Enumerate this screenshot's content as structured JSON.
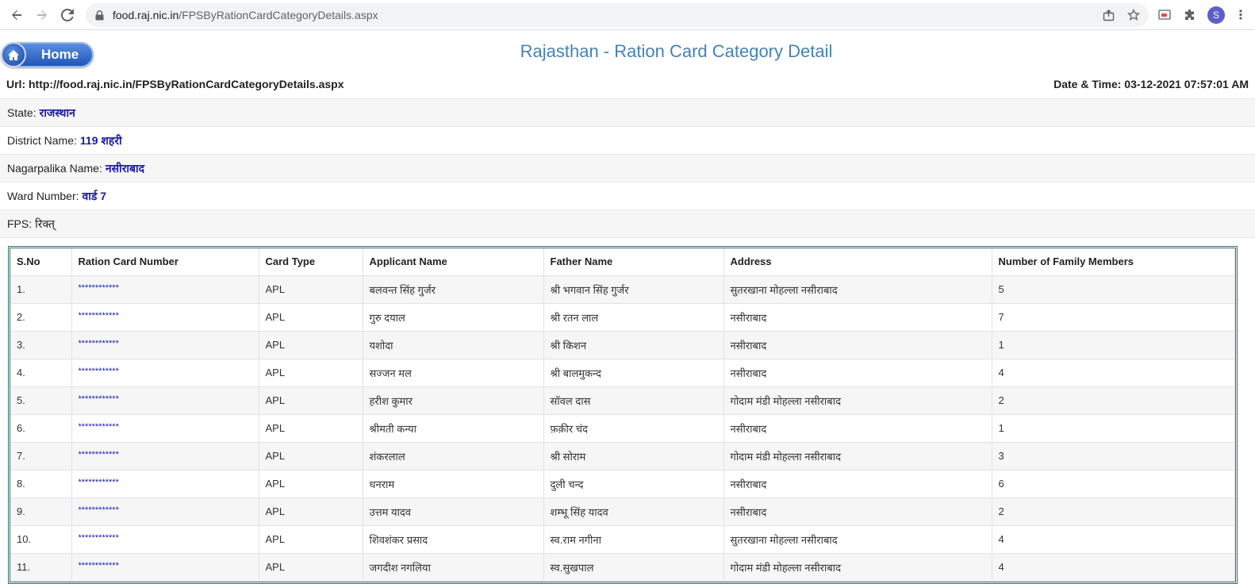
{
  "browser": {
    "url_domain": "food.raj.nic.in",
    "url_path": "/FPSByRationCardCategoryDetails.aspx",
    "avatar_letter": "S"
  },
  "header": {
    "home_label": "Home",
    "title": "Rajasthan - Ration Card Category Detail"
  },
  "info": {
    "url_label": "Url: http://food.raj.nic.in/FPSByRationCardCategoryDetails.aspx",
    "datetime_label": "Date & Time: 03-12-2021 07:57:01 AM"
  },
  "fields": {
    "state_label": "State:",
    "state_value": "राजस्थान",
    "district_label": "District Name:",
    "district_value": "119 शहरी",
    "nagarpalika_label": "Nagarpalika Name:",
    "nagarpalika_value": "नसीराबाद",
    "ward_label": "Ward Number:",
    "ward_value": "वार्ड 7",
    "fps_label": "FPS:",
    "fps_value": "रिक्त्"
  },
  "table": {
    "columns": [
      "S.No",
      "Ration Card Number",
      "Card Type",
      "Applicant Name",
      "Father Name",
      "Address",
      "Number of Family Members"
    ],
    "rows": [
      [
        "1.",
        "************",
        "APL",
        "बलवन्त सिंह गुर्जर",
        "श्री भगवान सिंह गुर्जर",
        "सुतरखाना मोहल्ला नसीराबाद",
        "5"
      ],
      [
        "2.",
        "************",
        "APL",
        "गुरु दयाल",
        "श्री रतन लाल",
        "नसीराबाद",
        "7"
      ],
      [
        "3.",
        "************",
        "APL",
        "यशोदा",
        "श्री किशन",
        "नसीराबाद",
        "1"
      ],
      [
        "4.",
        "************",
        "APL",
        "सज्जन मल",
        "श्री बालमुकन्द",
        "नसीराबाद",
        "4"
      ],
      [
        "5.",
        "************",
        "APL",
        "हरीश कुमार",
        "सॉवल दास",
        "गोदाम मंडी मोहल्ला नसीराबाद",
        "2"
      ],
      [
        "6.",
        "************",
        "APL",
        "श्रीमती कन्या",
        "फ़क़ीर चंद",
        "नसीराबाद",
        "1"
      ],
      [
        "7.",
        "************",
        "APL",
        "शंकरलाल",
        "श्री सोराम",
        "गोदाम मंडी मोहल्ला नसीराबाद",
        "3"
      ],
      [
        "8.",
        "************",
        "APL",
        "धनराम",
        "दुली चन्द",
        "नसीराबाद",
        "6"
      ],
      [
        "9.",
        "************",
        "APL",
        "उत्तम यादव",
        "शम्भू सिंह यादव",
        "नसीराबाद",
        "2"
      ],
      [
        "10.",
        "************",
        "APL",
        "शिवशंकर प्रसाद",
        "स्व.राम नगीना",
        "सुतरखाना मोहल्ला नसीराबाद",
        "4"
      ],
      [
        "11.",
        "************",
        "APL",
        "जगदीश नगलिया",
        "स्व.सुखपाल",
        "गोदाम मंडी मोहल्ला नसीराबाद",
        "4"
      ]
    ]
  }
}
